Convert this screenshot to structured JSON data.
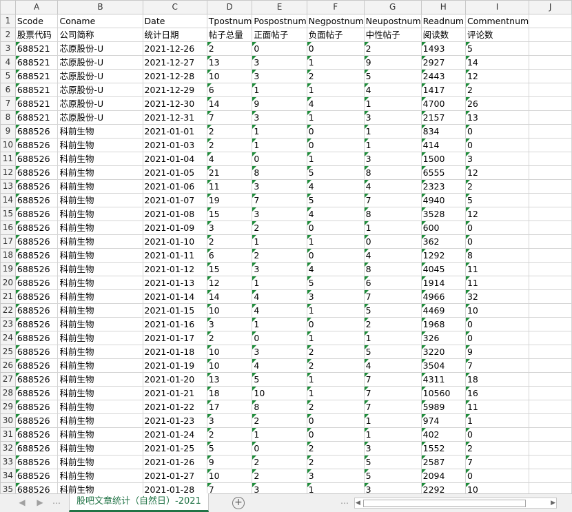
{
  "sheet_tab_label": "股吧文章统计（自然日）-2021",
  "columns": [
    "A",
    "B",
    "C",
    "D",
    "E",
    "F",
    "G",
    "H",
    "I",
    "J"
  ],
  "rows": [
    {
      "n": "1",
      "cells": [
        "Scode",
        "Coname",
        "Date",
        "Tpostnum",
        "Pospostnum",
        "Negpostnum",
        "Neupostnum",
        "Readnum",
        "Commentnum",
        ""
      ]
    },
    {
      "n": "2",
      "cells": [
        "股票代码",
        "公司简称",
        "统计日期",
        "帖子总量",
        "正面帖子",
        "负面帖子",
        "中性帖子",
        "阅读数",
        "评论数",
        ""
      ]
    },
    {
      "n": "3",
      "cells": [
        "688521",
        "芯原股份-U",
        "2021-12-26",
        "2",
        "0",
        "0",
        "2",
        "1493",
        "5",
        ""
      ]
    },
    {
      "n": "4",
      "cells": [
        "688521",
        "芯原股份-U",
        "2021-12-27",
        "13",
        "3",
        "1",
        "9",
        "2927",
        "14",
        ""
      ]
    },
    {
      "n": "5",
      "cells": [
        "688521",
        "芯原股份-U",
        "2021-12-28",
        "10",
        "3",
        "2",
        "5",
        "2443",
        "12",
        ""
      ]
    },
    {
      "n": "6",
      "cells": [
        "688521",
        "芯原股份-U",
        "2021-12-29",
        "6",
        "1",
        "1",
        "4",
        "1417",
        "2",
        ""
      ]
    },
    {
      "n": "7",
      "cells": [
        "688521",
        "芯原股份-U",
        "2021-12-30",
        "14",
        "9",
        "4",
        "1",
        "4700",
        "26",
        ""
      ]
    },
    {
      "n": "8",
      "cells": [
        "688521",
        "芯原股份-U",
        "2021-12-31",
        "7",
        "3",
        "1",
        "3",
        "2157",
        "13",
        ""
      ]
    },
    {
      "n": "9",
      "cells": [
        "688526",
        "科前生物",
        "2021-01-01",
        "2",
        "1",
        "0",
        "1",
        "834",
        "0",
        ""
      ]
    },
    {
      "n": "10",
      "cells": [
        "688526",
        "科前生物",
        "2021-01-03",
        "2",
        "1",
        "0",
        "1",
        "414",
        "0",
        ""
      ]
    },
    {
      "n": "11",
      "cells": [
        "688526",
        "科前生物",
        "2021-01-04",
        "4",
        "0",
        "1",
        "3",
        "1500",
        "3",
        ""
      ]
    },
    {
      "n": "12",
      "cells": [
        "688526",
        "科前生物",
        "2021-01-05",
        "21",
        "8",
        "5",
        "8",
        "6555",
        "12",
        ""
      ]
    },
    {
      "n": "13",
      "cells": [
        "688526",
        "科前生物",
        "2021-01-06",
        "11",
        "3",
        "4",
        "4",
        "2323",
        "2",
        ""
      ]
    },
    {
      "n": "14",
      "cells": [
        "688526",
        "科前生物",
        "2021-01-07",
        "19",
        "7",
        "5",
        "7",
        "4940",
        "5",
        ""
      ]
    },
    {
      "n": "15",
      "cells": [
        "688526",
        "科前生物",
        "2021-01-08",
        "15",
        "3",
        "4",
        "8",
        "3528",
        "12",
        ""
      ]
    },
    {
      "n": "16",
      "cells": [
        "688526",
        "科前生物",
        "2021-01-09",
        "3",
        "2",
        "0",
        "1",
        "600",
        "0",
        ""
      ]
    },
    {
      "n": "17",
      "cells": [
        "688526",
        "科前生物",
        "2021-01-10",
        "2",
        "1",
        "1",
        "0",
        "362",
        "0",
        ""
      ]
    },
    {
      "n": "18",
      "cells": [
        "688526",
        "科前生物",
        "2021-01-11",
        "6",
        "2",
        "0",
        "4",
        "1292",
        "8",
        ""
      ]
    },
    {
      "n": "19",
      "cells": [
        "688526",
        "科前生物",
        "2021-01-12",
        "15",
        "3",
        "4",
        "8",
        "4045",
        "11",
        ""
      ]
    },
    {
      "n": "20",
      "cells": [
        "688526",
        "科前生物",
        "2021-01-13",
        "12",
        "1",
        "5",
        "6",
        "1914",
        "11",
        ""
      ]
    },
    {
      "n": "21",
      "cells": [
        "688526",
        "科前生物",
        "2021-01-14",
        "14",
        "4",
        "3",
        "7",
        "4966",
        "32",
        ""
      ]
    },
    {
      "n": "22",
      "cells": [
        "688526",
        "科前生物",
        "2021-01-15",
        "10",
        "4",
        "1",
        "5",
        "4469",
        "10",
        ""
      ]
    },
    {
      "n": "23",
      "cells": [
        "688526",
        "科前生物",
        "2021-01-16",
        "3",
        "1",
        "0",
        "2",
        "1968",
        "0",
        ""
      ]
    },
    {
      "n": "24",
      "cells": [
        "688526",
        "科前生物",
        "2021-01-17",
        "2",
        "0",
        "1",
        "1",
        "326",
        "0",
        ""
      ]
    },
    {
      "n": "25",
      "cells": [
        "688526",
        "科前生物",
        "2021-01-18",
        "10",
        "3",
        "2",
        "5",
        "3220",
        "9",
        ""
      ]
    },
    {
      "n": "26",
      "cells": [
        "688526",
        "科前生物",
        "2021-01-19",
        "10",
        "4",
        "2",
        "4",
        "3504",
        "7",
        ""
      ]
    },
    {
      "n": "27",
      "cells": [
        "688526",
        "科前生物",
        "2021-01-20",
        "13",
        "5",
        "1",
        "7",
        "4311",
        "18",
        ""
      ]
    },
    {
      "n": "28",
      "cells": [
        "688526",
        "科前生物",
        "2021-01-21",
        "18",
        "10",
        "1",
        "7",
        "10560",
        "16",
        ""
      ]
    },
    {
      "n": "29",
      "cells": [
        "688526",
        "科前生物",
        "2021-01-22",
        "17",
        "8",
        "2",
        "7",
        "5989",
        "11",
        ""
      ]
    },
    {
      "n": "30",
      "cells": [
        "688526",
        "科前生物",
        "2021-01-23",
        "3",
        "2",
        "0",
        "1",
        "974",
        "1",
        ""
      ]
    },
    {
      "n": "31",
      "cells": [
        "688526",
        "科前生物",
        "2021-01-24",
        "2",
        "1",
        "0",
        "1",
        "402",
        "0",
        ""
      ]
    },
    {
      "n": "32",
      "cells": [
        "688526",
        "科前生物",
        "2021-01-25",
        "5",
        "0",
        "2",
        "3",
        "1552",
        "2",
        ""
      ]
    },
    {
      "n": "33",
      "cells": [
        "688526",
        "科前生物",
        "2021-01-26",
        "9",
        "2",
        "2",
        "5",
        "2587",
        "7",
        ""
      ]
    },
    {
      "n": "34",
      "cells": [
        "688526",
        "科前生物",
        "2021-01-27",
        "10",
        "2",
        "3",
        "5",
        "2094",
        "0",
        ""
      ]
    },
    {
      "n": "35",
      "cells": [
        "688526",
        "科前生物",
        "2021-01-28",
        "7",
        "3",
        "1",
        "3",
        "2292",
        "10",
        ""
      ]
    }
  ],
  "icons": {
    "tab_prev": "triangle-left-icon",
    "tab_next": "triangle-right-icon",
    "add_sheet": "plus-circle-icon",
    "scroll_left": "scroll-left-icon",
    "scroll_right": "scroll-right-icon"
  },
  "glyphs": {
    "ellipsis": "…",
    "plus": "+",
    "left": "◀",
    "right": "▶",
    "tab_prev": "◀",
    "tab_next": "▶"
  },
  "colors": {
    "accent": "#217346",
    "number_marker": "#1e8c3a",
    "grid": "#d4d4d4",
    "header_bg": "#f3f3f3"
  }
}
